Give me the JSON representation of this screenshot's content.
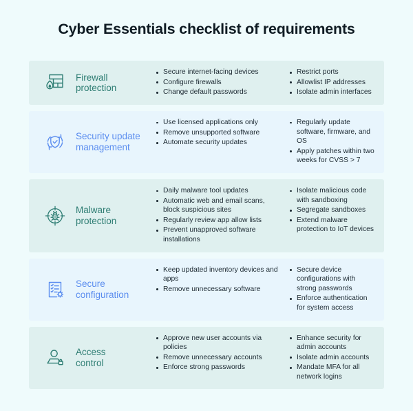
{
  "page": {
    "title": "Cyber Essentials checklist of requirements",
    "background_color": "#effbfc",
    "title_color": "#0f1b23"
  },
  "theme": {
    "teal_card_bg": "#dff0ef",
    "blue_card_bg": "#e8f5fd",
    "teal_accent": "#2e7d73",
    "blue_accent": "#5b8def",
    "bullet_text_color": "#1d2a33"
  },
  "rows": [
    {
      "id": "firewall-protection",
      "icon": "firewall-icon",
      "label": "Firewall\nprotection",
      "label_line1": "Firewall",
      "label_line2": "protection",
      "accent": "teal",
      "column1": [
        "Secure internet-facing devices",
        "Configure firewalls",
        "Change default passwords"
      ],
      "column2": [
        "Restrict ports",
        "Allowlist IP addresses",
        "Isolate admin interfaces"
      ]
    },
    {
      "id": "security-update-management",
      "icon": "shield-refresh-icon",
      "label": "Security update\nmanagement",
      "label_line1": "Security update",
      "label_line2": "management",
      "accent": "blue",
      "column1": [
        "Use licensed applications only",
        "Remove unsupported software",
        "Automate security updates"
      ],
      "column2": [
        "Regularly update software, firmware, and OS",
        "Apply patches within two weeks for CVSS > 7"
      ]
    },
    {
      "id": "malware-protection",
      "icon": "bug-target-icon",
      "label": "Malware\nprotection",
      "label_line1": "Malware",
      "label_line2": "protection",
      "accent": "teal",
      "column1": [
        "Daily malware tool updates",
        "Automatic web and email scans, block suspicious sites",
        "Regularly review app allow lists",
        "Prevent unapproved software installations"
      ],
      "column2": [
        "Isolate malicious code with sandboxing",
        "Segregate sandboxes",
        "Extend malware protection to IoT devices"
      ]
    },
    {
      "id": "secure-configuration",
      "icon": "checklist-gear-icon",
      "label": "Secure\nconfiguration",
      "label_line1": "Secure",
      "label_line2": "configuration",
      "accent": "blue",
      "column1": [
        "Keep updated inventory devices and apps",
        "Remove unnecessary software"
      ],
      "column2": [
        "Secure device configurations with strong passwords",
        "Enforce authentication for system access"
      ]
    },
    {
      "id": "access-control",
      "icon": "user-lock-icon",
      "label": "Access\ncontrol",
      "label_line1": "Access",
      "label_line2": "control",
      "accent": "teal",
      "column1": [
        "Approve new user accounts via policies",
        "Remove unnecessary accounts",
        "Enforce strong passwords"
      ],
      "column2": [
        "Enhance security for admin accounts",
        "Isolate admin accounts",
        "Mandate MFA for all network logins"
      ]
    }
  ]
}
